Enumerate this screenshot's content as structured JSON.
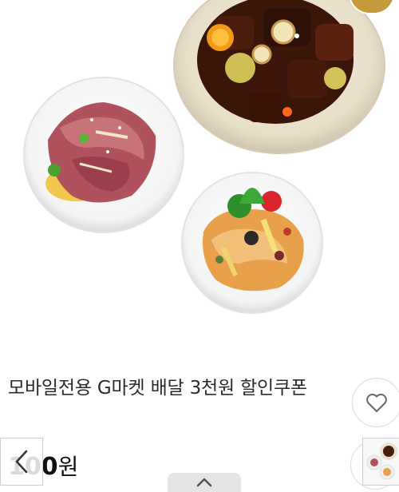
{
  "product": {
    "title": "모바일전용 G마켓 배달 3천원 할인쿠폰",
    "price_number": "100",
    "price_unit": "원"
  },
  "icons": {
    "favorite": "heart-outline-icon",
    "back": "chevron-left-icon",
    "scroll_top": "chevron-up-icon"
  },
  "colors": {
    "accent_badge": "#c49a3a",
    "border": "#dcdcdc"
  }
}
